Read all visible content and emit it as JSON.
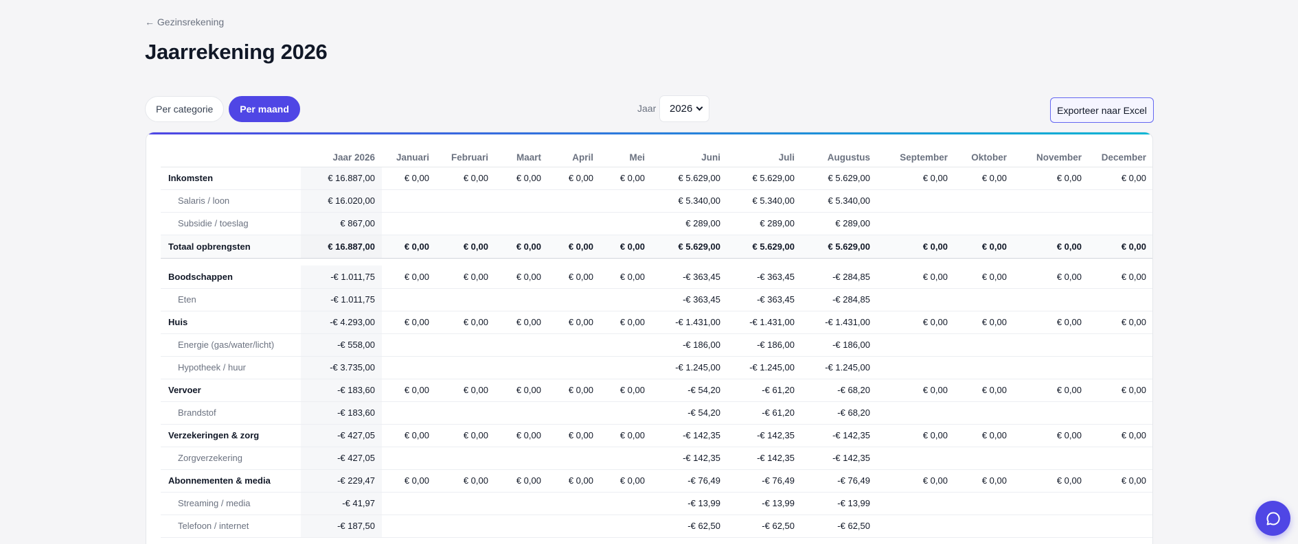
{
  "nav": {
    "back_label": "← Gezinsrekening"
  },
  "page": {
    "title": "Jaarrekening 2026"
  },
  "view_toggle": {
    "per_category": "Per categorie",
    "per_month": "Per maand",
    "active": "per_month"
  },
  "year_filter": {
    "label": "Jaar",
    "selected": "2026"
  },
  "actions": {
    "export_label": "Exporteer naar Excel"
  },
  "colors": {
    "accent": "#4f46e5",
    "accent_gradient_end": "#06b6d4",
    "background": "#f5f5f7"
  },
  "table": {
    "columns": [
      "",
      "Jaar 2026",
      "Januari",
      "Februari",
      "Maart",
      "April",
      "Mei",
      "Juni",
      "Juli",
      "Augustus",
      "September",
      "Oktober",
      "November",
      "December"
    ],
    "rows": [
      {
        "kind": "cat",
        "cells": [
          "Inkomsten",
          "€ 16.887,00",
          "€ 0,00",
          "€ 0,00",
          "€ 0,00",
          "€ 0,00",
          "€ 0,00",
          "€ 5.629,00",
          "€ 5.629,00",
          "€ 5.629,00",
          "€ 0,00",
          "€ 0,00",
          "€ 0,00",
          "€ 0,00"
        ]
      },
      {
        "kind": "sub",
        "cells": [
          "Salaris / loon",
          "€ 16.020,00",
          "",
          "",
          "",
          "",
          "",
          "€ 5.340,00",
          "€ 5.340,00",
          "€ 5.340,00",
          "",
          "",
          "",
          ""
        ]
      },
      {
        "kind": "sub",
        "cells": [
          "Subsidie / toeslag",
          "€ 867,00",
          "",
          "",
          "",
          "",
          "",
          "€ 289,00",
          "€ 289,00",
          "€ 289,00",
          "",
          "",
          "",
          ""
        ]
      },
      {
        "kind": "total",
        "cells": [
          "Totaal opbrengsten",
          "€ 16.887,00",
          "€ 0,00",
          "€ 0,00",
          "€ 0,00",
          "€ 0,00",
          "€ 0,00",
          "€ 5.629,00",
          "€ 5.629,00",
          "€ 5.629,00",
          "€ 0,00",
          "€ 0,00",
          "€ 0,00",
          "€ 0,00"
        ]
      },
      {
        "kind": "spacer",
        "cells": []
      },
      {
        "kind": "cat",
        "cells": [
          "Boodschappen",
          "-€ 1.011,75",
          "€ 0,00",
          "€ 0,00",
          "€ 0,00",
          "€ 0,00",
          "€ 0,00",
          "-€ 363,45",
          "-€ 363,45",
          "-€ 284,85",
          "€ 0,00",
          "€ 0,00",
          "€ 0,00",
          "€ 0,00"
        ]
      },
      {
        "kind": "sub",
        "cells": [
          "Eten",
          "-€ 1.011,75",
          "",
          "",
          "",
          "",
          "",
          "-€ 363,45",
          "-€ 363,45",
          "-€ 284,85",
          "",
          "",
          "",
          ""
        ]
      },
      {
        "kind": "cat",
        "cells": [
          "Huis",
          "-€ 4.293,00",
          "€ 0,00",
          "€ 0,00",
          "€ 0,00",
          "€ 0,00",
          "€ 0,00",
          "-€ 1.431,00",
          "-€ 1.431,00",
          "-€ 1.431,00",
          "€ 0,00",
          "€ 0,00",
          "€ 0,00",
          "€ 0,00"
        ]
      },
      {
        "kind": "sub",
        "cells": [
          "Energie (gas/water/licht)",
          "-€ 558,00",
          "",
          "",
          "",
          "",
          "",
          "-€ 186,00",
          "-€ 186,00",
          "-€ 186,00",
          "",
          "",
          "",
          ""
        ]
      },
      {
        "kind": "sub",
        "cells": [
          "Hypotheek / huur",
          "-€ 3.735,00",
          "",
          "",
          "",
          "",
          "",
          "-€ 1.245,00",
          "-€ 1.245,00",
          "-€ 1.245,00",
          "",
          "",
          "",
          ""
        ]
      },
      {
        "kind": "cat",
        "cells": [
          "Vervoer",
          "-€ 183,60",
          "€ 0,00",
          "€ 0,00",
          "€ 0,00",
          "€ 0,00",
          "€ 0,00",
          "-€ 54,20",
          "-€ 61,20",
          "-€ 68,20",
          "€ 0,00",
          "€ 0,00",
          "€ 0,00",
          "€ 0,00"
        ]
      },
      {
        "kind": "sub",
        "cells": [
          "Brandstof",
          "-€ 183,60",
          "",
          "",
          "",
          "",
          "",
          "-€ 54,20",
          "-€ 61,20",
          "-€ 68,20",
          "",
          "",
          "",
          ""
        ]
      },
      {
        "kind": "cat",
        "cells": [
          "Verzekeringen & zorg",
          "-€ 427,05",
          "€ 0,00",
          "€ 0,00",
          "€ 0,00",
          "€ 0,00",
          "€ 0,00",
          "-€ 142,35",
          "-€ 142,35",
          "-€ 142,35",
          "€ 0,00",
          "€ 0,00",
          "€ 0,00",
          "€ 0,00"
        ]
      },
      {
        "kind": "sub",
        "cells": [
          "Zorgverzekering",
          "-€ 427,05",
          "",
          "",
          "",
          "",
          "",
          "-€ 142,35",
          "-€ 142,35",
          "-€ 142,35",
          "",
          "",
          "",
          ""
        ]
      },
      {
        "kind": "cat",
        "cells": [
          "Abonnementen & media",
          "-€ 229,47",
          "€ 0,00",
          "€ 0,00",
          "€ 0,00",
          "€ 0,00",
          "€ 0,00",
          "-€ 76,49",
          "-€ 76,49",
          "-€ 76,49",
          "€ 0,00",
          "€ 0,00",
          "€ 0,00",
          "€ 0,00"
        ]
      },
      {
        "kind": "sub",
        "cells": [
          "Streaming / media",
          "-€ 41,97",
          "",
          "",
          "",
          "",
          "",
          "-€ 13,99",
          "-€ 13,99",
          "-€ 13,99",
          "",
          "",
          "",
          ""
        ]
      },
      {
        "kind": "sub",
        "cells": [
          "Telefoon / internet",
          "-€ 187,50",
          "",
          "",
          "",
          "",
          "",
          "-€ 62,50",
          "-€ 62,50",
          "-€ 62,50",
          "",
          "",
          "",
          ""
        ]
      }
    ]
  },
  "chat": {
    "icon": "chat-bubble-icon"
  }
}
